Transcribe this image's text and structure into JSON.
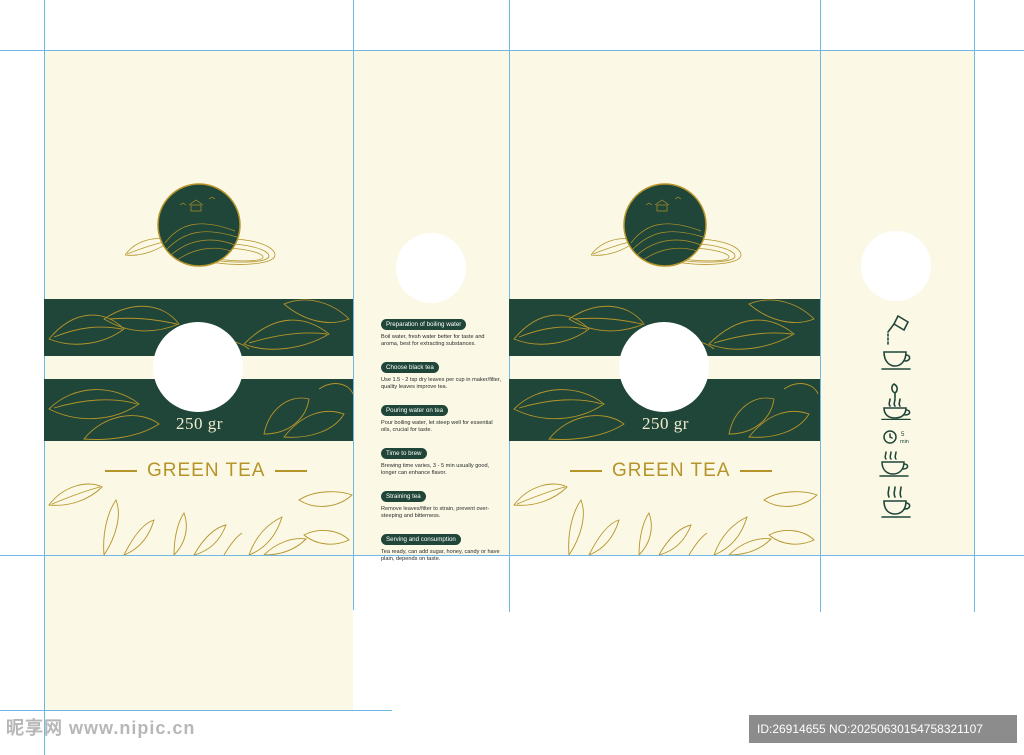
{
  "package": {
    "weight_label": "250 gr",
    "product_title": "GREEN TEA"
  },
  "brewing_steps": [
    {
      "label": "Preparation of boiling water",
      "text": "Boil water, fresh water better for taste and aroma, best for extracting substances."
    },
    {
      "label": "Choose black tea",
      "text": "Use 1.5 - 2 tsp dry leaves per cup in maker/filter, quality leaves improve tea."
    },
    {
      "label": "Pouring water on tea",
      "text": "Pour boiling water, let steep well for essential oils, crucial for taste."
    },
    {
      "label": "Time to brew",
      "text": "Brewing time varies, 3 - 5 min usually good, longer can enhance flavor."
    },
    {
      "label": "Straining tea",
      "text": "Remove leaves/filter to strain, prevent over-steeping and bitterness."
    },
    {
      "label": "Serving and consumption",
      "text": "Tea ready, can add sugar, honey, candy or have plain, depends on taste."
    }
  ],
  "brew_icons": {
    "timer_value": "5",
    "timer_unit": "min",
    "names": [
      "kettle-pour-icon",
      "tea-leaves-cup-icon",
      "timer-cup-icon",
      "steaming-cup-icon"
    ]
  },
  "watermark": {
    "site": "昵享网 www.nipic.cn",
    "id_text": "ID:26914655 NO:20250630154758321107"
  },
  "colors": {
    "cream": "#fbf9e6",
    "dark_green": "#1f4638",
    "gold": "#b5942a",
    "guide": "#6fb8e6"
  }
}
